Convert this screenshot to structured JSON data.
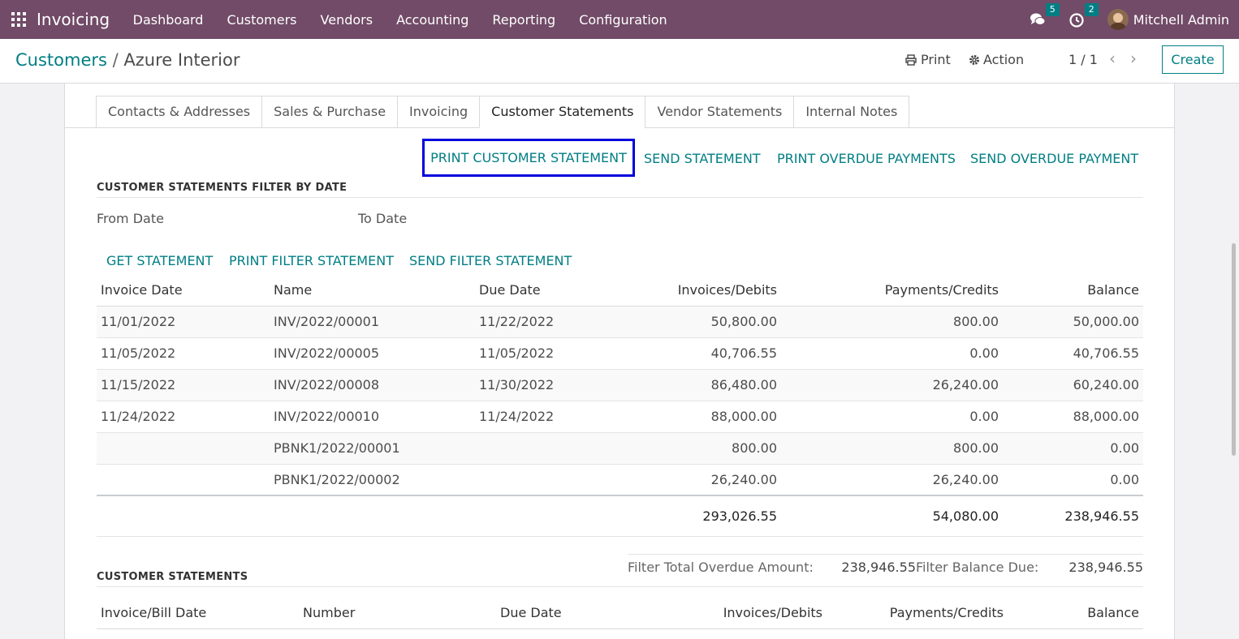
{
  "navbar": {
    "app_name": "Invoicing",
    "menu": [
      "Dashboard",
      "Customers",
      "Vendors",
      "Accounting",
      "Reporting",
      "Configuration"
    ],
    "messages_count": "5",
    "activities_count": "2",
    "user_name": "Mitchell Admin",
    "background_color": "#714b67"
  },
  "control": {
    "breadcrumb_parent": "Customers",
    "breadcrumb_sep": "/",
    "breadcrumb_current": "Azure Interior",
    "print_label": "Print",
    "action_label": "Action",
    "pager": "1 / 1",
    "create_label": "Create"
  },
  "tabs": [
    "Contacts & Addresses",
    "Sales & Purchase",
    "Invoicing",
    "Customer Statements",
    "Vendor Statements",
    "Internal Notes"
  ],
  "active_tab": "Customer Statements",
  "buttons": {
    "print_customer_statement": "PRINT CUSTOMER STATEMENT",
    "send_statement": "SEND STATEMENT",
    "print_overdue_payments": "PRINT OVERDUE PAYMENTS",
    "send_overdue_payment": "SEND OVERDUE PAYMENT",
    "get_statement": "GET STATEMENT",
    "print_filter_statement": "PRINT FILTER STATEMENT",
    "send_filter_statement": "SEND FILTER STATEMENT"
  },
  "filter_section": {
    "title": "CUSTOMER STATEMENTS FILTER BY DATE",
    "from_date_label": "From Date",
    "to_date_label": "To Date"
  },
  "filter_table": {
    "headers": [
      "Invoice Date",
      "Name",
      "Due Date",
      "Invoices/Debits",
      "Payments/Credits",
      "Balance"
    ],
    "rows": [
      [
        "11/01/2022",
        "INV/2022/00001",
        "11/22/2022",
        "50,800.00",
        "800.00",
        "50,000.00"
      ],
      [
        "11/05/2022",
        "INV/2022/00005",
        "11/05/2022",
        "40,706.55",
        "0.00",
        "40,706.55"
      ],
      [
        "11/15/2022",
        "INV/2022/00008",
        "11/30/2022",
        "86,480.00",
        "26,240.00",
        "60,240.00"
      ],
      [
        "11/24/2022",
        "INV/2022/00010",
        "11/24/2022",
        "88,000.00",
        "0.00",
        "88,000.00"
      ],
      [
        "",
        "PBNK1/2022/00001",
        "",
        "800.00",
        "800.00",
        "0.00"
      ],
      [
        "",
        "PBNK1/2022/00002",
        "",
        "26,240.00",
        "26,240.00",
        "0.00"
      ]
    ],
    "totals": [
      "293,026.55",
      "54,080.00",
      "238,946.55"
    ]
  },
  "summary": {
    "overdue_label": "Filter Total Overdue Amount:",
    "overdue_value": "238,946.55",
    "balance_label": "Filter Balance Due:",
    "balance_value": "238,946.55"
  },
  "statements_section": {
    "title": "CUSTOMER STATEMENTS",
    "headers": [
      "Invoice/Bill Date",
      "Number",
      "Due Date",
      "Invoices/Debits",
      "Payments/Credits",
      "Balance"
    ]
  }
}
